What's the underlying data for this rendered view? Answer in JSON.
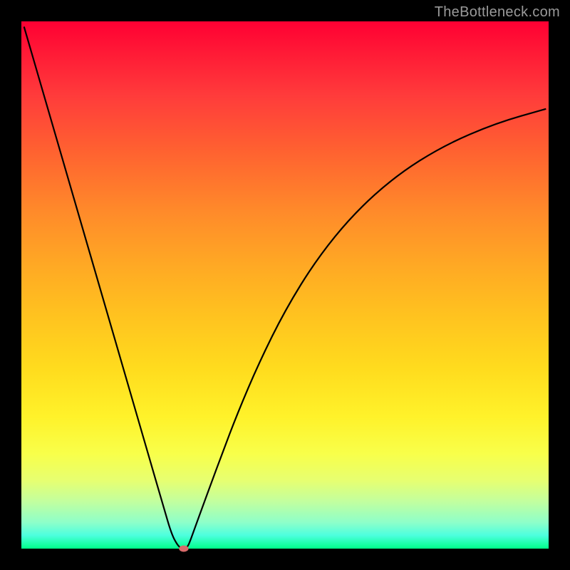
{
  "watermark": "TheBottleneck.com",
  "chart_data": {
    "type": "line",
    "title": "",
    "xlabel": "",
    "ylabel": "",
    "xlim": [
      0,
      100
    ],
    "ylim": [
      0,
      100
    ],
    "grid": false,
    "legend": false,
    "series": [
      {
        "name": "bottleneck-curve",
        "x": [
          0.5,
          5,
          10,
          15,
          20,
          24,
          27,
          28.5,
          29.7,
          30.5,
          31,
          31.5,
          32,
          33,
          34.5,
          36,
          38,
          41,
          45,
          50,
          56,
          63,
          71,
          80,
          90,
          99.5
        ],
        "y": [
          99,
          83.5,
          66.3,
          49.1,
          31.9,
          18.1,
          7.8,
          2.7,
          0.5,
          0,
          0,
          0.3,
          1.4,
          4.2,
          8.3,
          12.4,
          17.8,
          25.7,
          35.1,
          45.2,
          54.9,
          63.5,
          70.7,
          76.4,
          80.7,
          83.4
        ]
      }
    ],
    "annotations": [
      {
        "type": "ellipse-marker",
        "name": "optimum-point",
        "x": 30.8,
        "y": 0,
        "rx": 0.9,
        "ry": 0.6,
        "color": "#d96a6a"
      }
    ],
    "background": {
      "type": "vertical-gradient",
      "stops": [
        {
          "pos": 0,
          "color": "#ff0033"
        },
        {
          "pos": 50,
          "color": "#ffa824"
        },
        {
          "pos": 80,
          "color": "#fff22a"
        },
        {
          "pos": 100,
          "color": "#00ff8a"
        }
      ]
    }
  }
}
